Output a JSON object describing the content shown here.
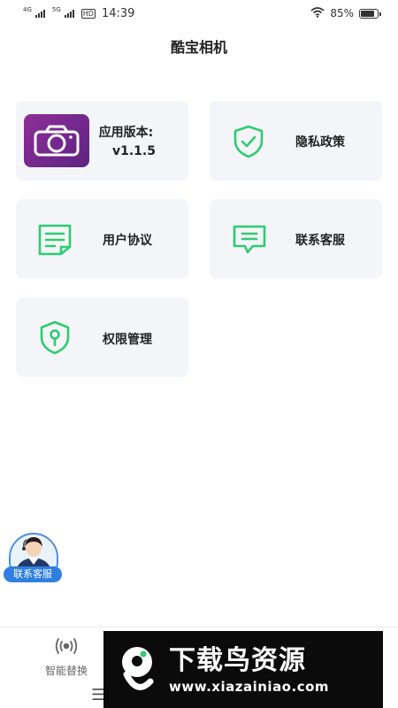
{
  "status_bar": {
    "network_1": "4G",
    "network_2": "5G",
    "hd": "HD",
    "time": "14:39",
    "battery_level": "85%",
    "battery_fraction": 0.85
  },
  "header": {
    "title": "酷宝相机"
  },
  "cards": {
    "version_label": "应用版本:",
    "version_value": "v1.1.5",
    "privacy": "隐私政策",
    "agreement": "用户协议",
    "contact": "联系客服",
    "permissions": "权限管理"
  },
  "support_float": {
    "label": "联系客服"
  },
  "bottom_nav": {
    "tab_1": "智能替换",
    "home_indicator": "☰"
  },
  "watermark": {
    "title": "下载鸟资源",
    "url": "www.xiazainiao.com"
  },
  "colors": {
    "accent_green": "#2ecc71",
    "camera_purple": "#7a2a8e",
    "card_bg": "#f4f5f8",
    "support_blue": "#2f7fe0"
  },
  "icons": {
    "privacy": "shield-check-icon",
    "agreement": "document-lines-icon",
    "contact": "chat-bubble-icon",
    "permissions": "shield-lock-icon",
    "app": "camera-icon",
    "nav": "broadcast-icon"
  }
}
